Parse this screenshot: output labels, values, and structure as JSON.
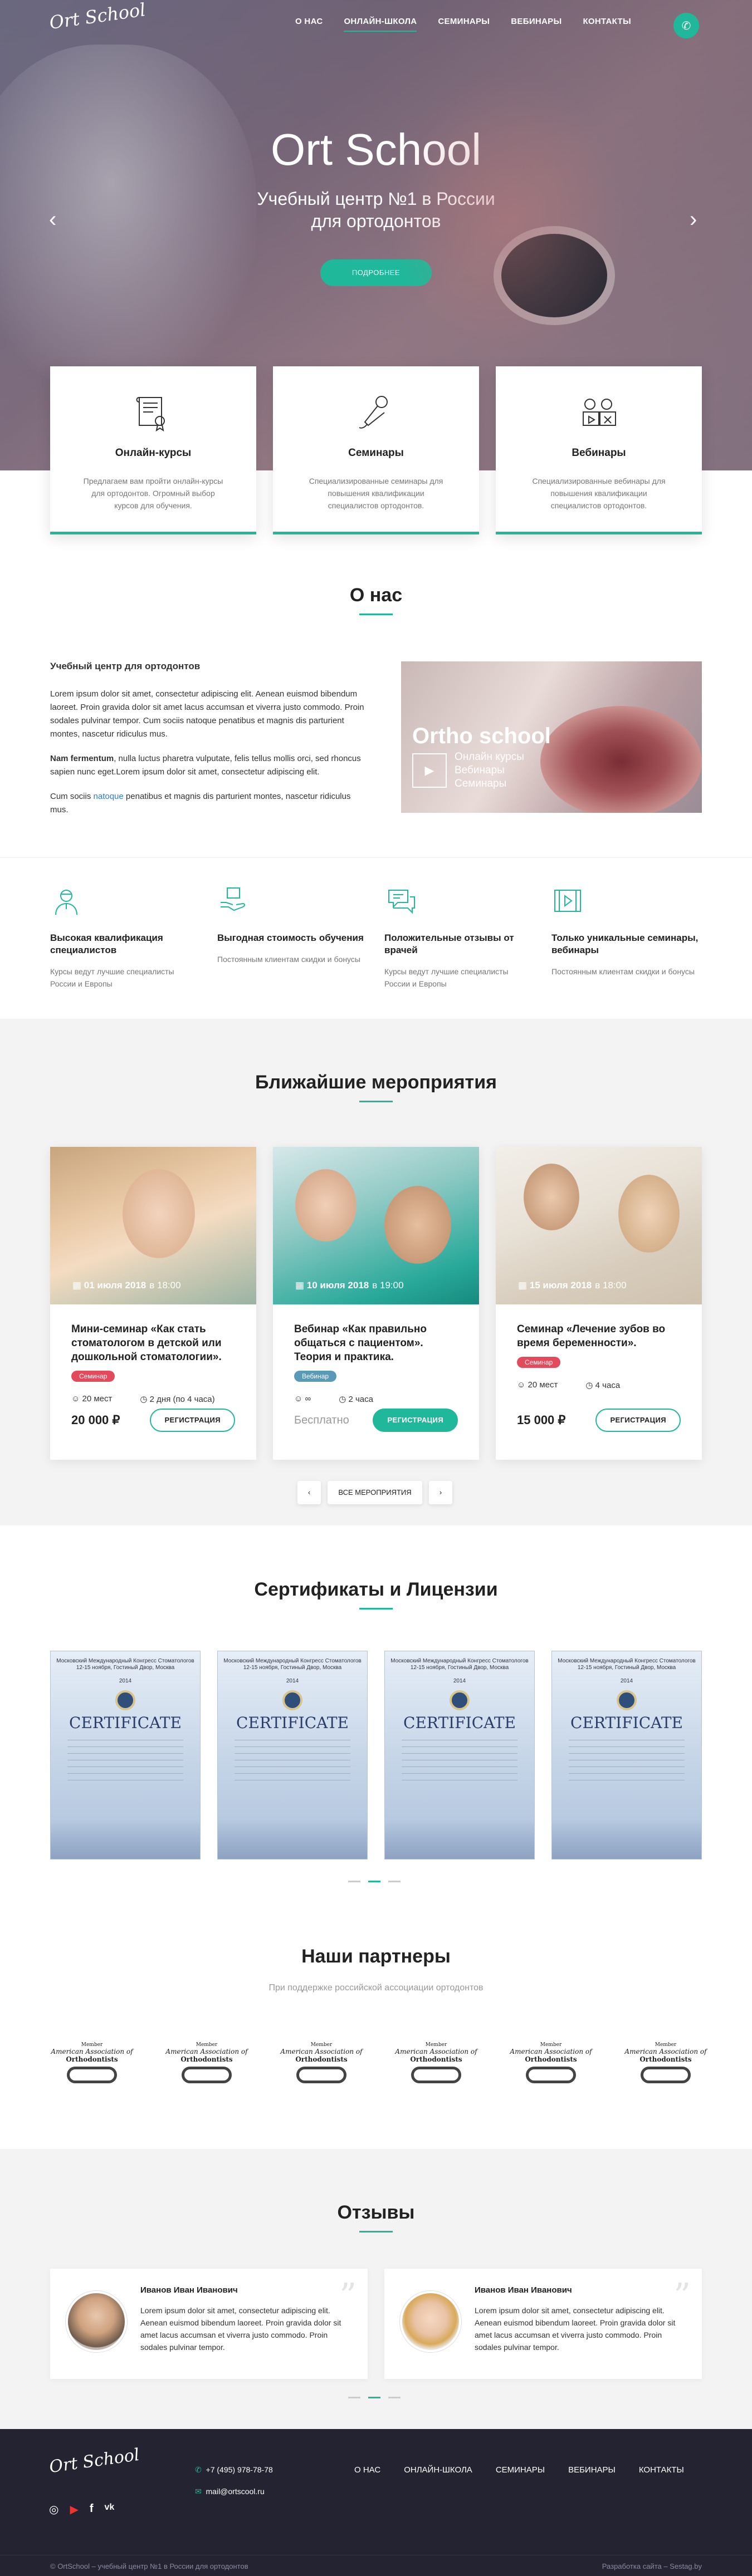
{
  "brand": {
    "logo_text": "Ort School"
  },
  "nav": {
    "items": [
      "О НАС",
      "ОНЛАЙН-ШКОЛА",
      "СЕМИНАРЫ",
      "ВЕБИНАРЫ",
      "КОНТАКТЫ"
    ],
    "active_index": 1
  },
  "hero": {
    "title": "Ort School",
    "subtitle_line1": "Учебный центр №1 в России",
    "subtitle_line2": "для ортодонтов",
    "button": "ПОДРОБНЕЕ",
    "prev": "‹",
    "next": "›"
  },
  "services": [
    {
      "icon": "certificate-icon",
      "title": "Онлайн-курсы",
      "text": "Предлагаем вам пройти онлайн-курсы для ортодонтов. Огромный выбор курсов для обучения."
    },
    {
      "icon": "microphone-icon",
      "title": "Семинары",
      "text": "Специализированные семинары для повышения квалификации специалистов ортодонтов."
    },
    {
      "icon": "webinar-icon",
      "title": "Вебинары",
      "text": "Специализированные вебинары для повышения квалификации специалистов ортодонтов."
    }
  ],
  "about": {
    "title": "О нас",
    "heading": "Учебный центр для ортодонтов",
    "p1": "Lorem ipsum dolor sit amet, consectetur adipiscing elit. Aenean euismod bibendum laoreet. Proin gravida dolor sit amet lacus accumsan et viverra justo commodo. Proin sodales pulvinar tempor. Cum sociis natoque penatibus et magnis dis parturient montes, nascetur ridiculus mus.",
    "p2_bold": "Nam fermentum",
    "p2": ", nulla luctus pharetra vulputate, felis tellus mollis orci, sed rhoncus sapien nunc eget.Lorem ipsum dolor sit amet, consectetur adipiscing elit.",
    "p3_a": "Cum sociis ",
    "p3_link": "natoque",
    "p3_b": " penatibus et magnis dis parturient montes, nascetur ridiculus mus.",
    "image_title": "Ortho school",
    "image_list": [
      "Онлайн курсы",
      "Вебинары",
      "Семинары"
    ]
  },
  "features": [
    {
      "icon": "doctor-icon",
      "title": "Высокая квалификация специалистов",
      "text": "Курсы ведут лучшие специалисты России и Европы"
    },
    {
      "icon": "hand-box-icon",
      "title": "Выгодная стоимость обучения",
      "text": "Постоянным клиентам скидки и бонусы"
    },
    {
      "icon": "chat-icon",
      "title": "Положительные отзывы от врачей",
      "text": "Курсы ведут лучшие специалисты России и Европы"
    },
    {
      "icon": "video-icon",
      "title": "Только уникальные семинары, вебинары",
      "text": "Постоянным клиентам скидки и бонусы"
    }
  ],
  "events": {
    "title": "Ближайшие мероприятия",
    "items": [
      {
        "date": "01 июля 2018",
        "time": "в 18:00",
        "title": "Мини-семинар «Как стать стоматологом в детской или дошкольной стоматологии».",
        "tag": "Семинар",
        "tag_color": "#e34b5d",
        "seats": "20 мест",
        "duration": "2 дня (по 4 часа)",
        "price": "20 000 ₽",
        "button": "РЕГИСТРАЦИЯ"
      },
      {
        "date": "10 июля 2018",
        "time": "в 19:00",
        "title": "Вебинар «Как правильно общаться с  пациентом». Теория и практика.",
        "tag": "Вебинар",
        "tag_color": "#5a9ab8",
        "seats": "∞",
        "duration": "2 часа",
        "price": "Бесплатно",
        "button": "РЕГИСТРАЦИЯ"
      },
      {
        "date": "15 июля 2018",
        "time": "в 18:00",
        "title": "Семинар «Лечение зубов во время беременности».",
        "tag": "Семинар",
        "tag_color": "#e34b5d",
        "seats": "20 мест",
        "duration": "4 часа",
        "price": "15 000 ₽",
        "button": "РЕГИСТРАЦИЯ"
      }
    ],
    "all_button": "ВСЕ МЕРОПРИЯТИЯ",
    "prev": "‹",
    "next": "›"
  },
  "certificates": {
    "title": "Сертификаты и Лицензии",
    "header": "Московский Международный Конгресс Стоматологов 12-15 ноября, Гостиный Двор, Москва",
    "year": "2014",
    "word": "CERTIFICATE",
    "count": 4
  },
  "partners": {
    "title": "Наши партнеры",
    "subtitle": "При поддержке российской ассоциации ортодонтов",
    "logo_small": "Member",
    "logo_name": "American Association of",
    "logo_org": "Orthodontists"
  },
  "reviews": {
    "title": "Отзывы",
    "items": [
      {
        "name": "Иванов Иван Иванович",
        "text": "Lorem ipsum dolor sit amet, consectetur adipiscing elit. Aenean euismod bibendum laoreet. Proin gravida dolor sit amet lacus accumsan et viverra justo commodo. Proin sodales pulvinar tempor."
      },
      {
        "name": "Иванов Иван Иванович",
        "text": "Lorem ipsum dolor sit amet, consectetur adipiscing elit. Aenean euismod bibendum laoreet. Proin gravida dolor sit amet lacus accumsan et viverra justo commodo. Proin sodales pulvinar tempor."
      }
    ]
  },
  "footer": {
    "phone": "+7 (495) 978-78-78",
    "email": "mail@ortscool.ru",
    "copyright": "© OrtSchool – учебный центр №1 в России для ортодонтов",
    "credit": "Разработка сайта – Sestag.by",
    "social": [
      "instagram-icon",
      "youtube-icon",
      "facebook-icon",
      "vk-icon"
    ]
  },
  "colors": {
    "accent": "#1fb89a",
    "dark": "#232331",
    "tag_red": "#e34b5d",
    "tag_blue": "#5a9ab8"
  }
}
